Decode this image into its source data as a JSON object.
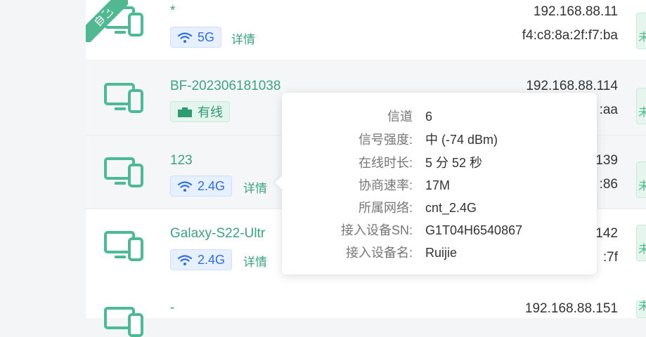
{
  "devices": [
    {
      "name": "*",
      "conn_type": "wifi",
      "conn_label": "5G",
      "detail_label": "详情",
      "ip": "192.168.88.11",
      "mac": "f4:c8:8a:2f:f7:ba",
      "corner_tag": "自己",
      "side_label": "未"
    },
    {
      "name": "BF-202306181038",
      "conn_type": "wired",
      "conn_label": "有线",
      "ip": "192.168.88.114",
      "mac": ":aa",
      "side_label": "未"
    },
    {
      "name": "123",
      "conn_type": "wifi",
      "conn_label": "2.4G",
      "detail_label": "详情",
      "ip": "139",
      "mac": ":86",
      "side_label": "未"
    },
    {
      "name": "Galaxy-S22-Ultr",
      "conn_type": "wifi",
      "conn_label": "2.4G",
      "detail_label": "详情",
      "ip": "142",
      "mac": ":7f",
      "side_label": "未"
    },
    {
      "name": "-",
      "ip": "192.168.88.151",
      "side_label": "未"
    }
  ],
  "tooltip": {
    "rows": [
      {
        "label": "信道",
        "value": "6"
      },
      {
        "label": "信号强度:",
        "value": "中 (-74 dBm)"
      },
      {
        "label": "在线时长:",
        "value": "5 分 52 秒"
      },
      {
        "label": "协商速率:",
        "value": "17M"
      },
      {
        "label": "所属网络:",
        "value": "cnt_2.4G"
      },
      {
        "label": "接入设备SN:",
        "value": "G1T04H6540867"
      },
      {
        "label": "接入设备名:",
        "value": "Ruijie"
      }
    ]
  },
  "colors": {
    "accent": "#3aa57e",
    "wifi_blue": "#2f6ee8",
    "tag_green": "#52b891"
  },
  "icons": {
    "device": "desktop-phone-icon",
    "wifi": "wifi-icon",
    "wired": "ethernet-icon"
  }
}
